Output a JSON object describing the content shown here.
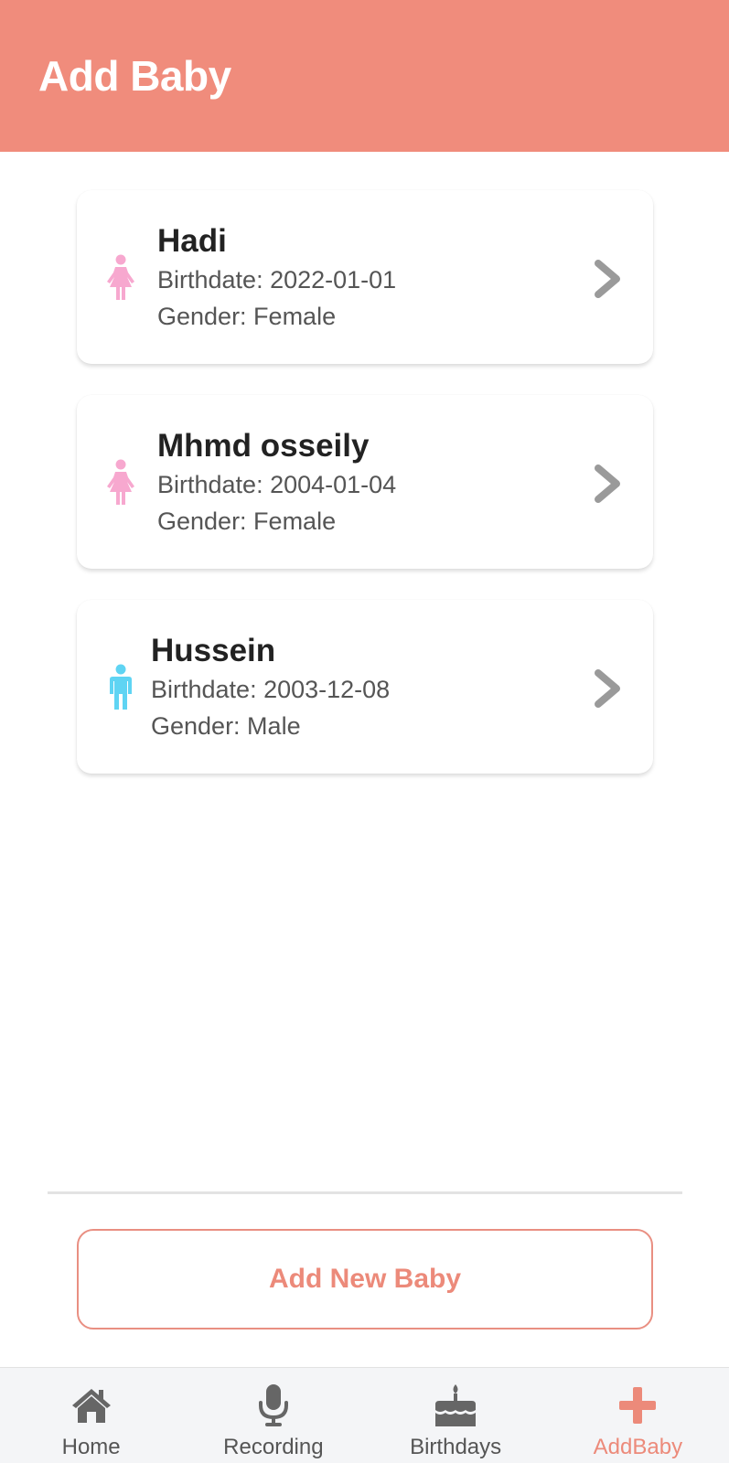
{
  "header": {
    "title": "Add Baby"
  },
  "babies": [
    {
      "name": "Hadi",
      "birthdate": "Birthdate: 2022-01-01",
      "gender": "Gender: Female",
      "gender_icon": "female-icon"
    },
    {
      "name": "Mhmd osseily",
      "birthdate": "Birthdate: 2004-01-04",
      "gender": "Gender: Female",
      "gender_icon": "female-icon"
    },
    {
      "name": "Hussein",
      "birthdate": "Birthdate: 2003-12-08",
      "gender": "Gender: Male",
      "gender_icon": "male-icon"
    }
  ],
  "add_button": {
    "label": "Add New Baby"
  },
  "tabbar": {
    "tabs": [
      {
        "label": "Home",
        "icon": "home-icon",
        "active": false
      },
      {
        "label": "Recording",
        "icon": "microphone-icon",
        "active": false
      },
      {
        "label": "Birthdays",
        "icon": "cake-icon",
        "active": false
      },
      {
        "label": "AddBaby",
        "icon": "plus-icon",
        "active": true
      }
    ]
  },
  "colors": {
    "header_bg": "#f08c7c",
    "accent": "#ec8a7a",
    "female": "#f7a8cf",
    "male": "#5fd4f3",
    "chevron": "#9a9a9a",
    "tab_icon": "#666666"
  }
}
